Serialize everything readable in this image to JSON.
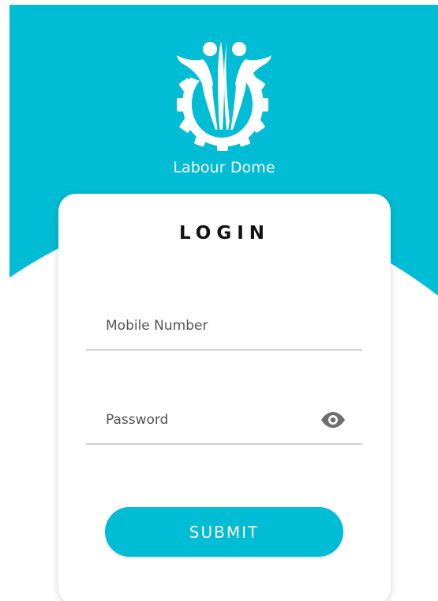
{
  "brand": {
    "name": "Labour Dome",
    "logo_icon": "labour-dome-gear-people-icon"
  },
  "login": {
    "title": "LOGIN",
    "mobile_placeholder": "Mobile Number",
    "password_placeholder": "Password",
    "password_toggle_icon": "eye-icon",
    "submit_label": "SUBMIT"
  },
  "colors": {
    "accent": "#00bcd4",
    "card": "#ffffff",
    "text": "#111111"
  }
}
